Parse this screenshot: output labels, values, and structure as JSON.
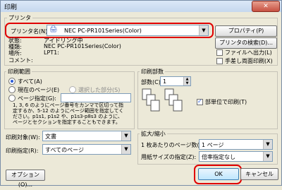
{
  "window": {
    "title": "印刷",
    "close": "✕"
  },
  "printer": {
    "section_label": "プリンタ",
    "name_label": "プリンタ名(N):",
    "name_value": "NEC PC-PR101Series(Color)",
    "properties_button": "プロパティ(P)",
    "find_button": "プリンタの検索(D)...",
    "status_label": "状態:",
    "status_value": "アイドリング中",
    "type_label": "種類:",
    "type_value": "NEC PC-PR101Series(Color)",
    "location_label": "場所:",
    "location_value": "LPT1:",
    "comment_label": "コメント:",
    "print_to_file": "ファイルへ出力(L)",
    "manual_duplex": "手差し両面印刷(X)"
  },
  "range": {
    "label": "印刷範囲",
    "all": "すべて(A)",
    "current": "現在のページ(E)",
    "selection": "選択した部分(S)",
    "pages": "ページ指定(G):",
    "help": "1, 3, 6 のようにページ番号をカンマで区切って指定するか、5-12 のようにページ範囲を指定してください。p1s1, p1s2 や、p1s3-p8s3 のように、ページとセクションを指定することもできます。"
  },
  "copies": {
    "label": "印刷部数",
    "count_label": "部数(C):",
    "count_value": "1",
    "collate": "部単位で印刷(T)"
  },
  "target": {
    "label": "印刷対象(W):",
    "value": "文書"
  },
  "spec": {
    "label": "印刷指定(R):",
    "value": "すべてのページ"
  },
  "zoom": {
    "label": "拡大/縮小",
    "pages_label": "1 枚あたりのページ数(H):",
    "pages_value": "1 ページ",
    "size_label": "用紙サイズの指定(Z):",
    "size_value": "倍率指定なし"
  },
  "footer": {
    "options": "オプション(O)...",
    "ok": "OK",
    "cancel": "キャンセル"
  },
  "colors": {
    "highlight": "#e00000",
    "accent": "#2a5bd7"
  }
}
